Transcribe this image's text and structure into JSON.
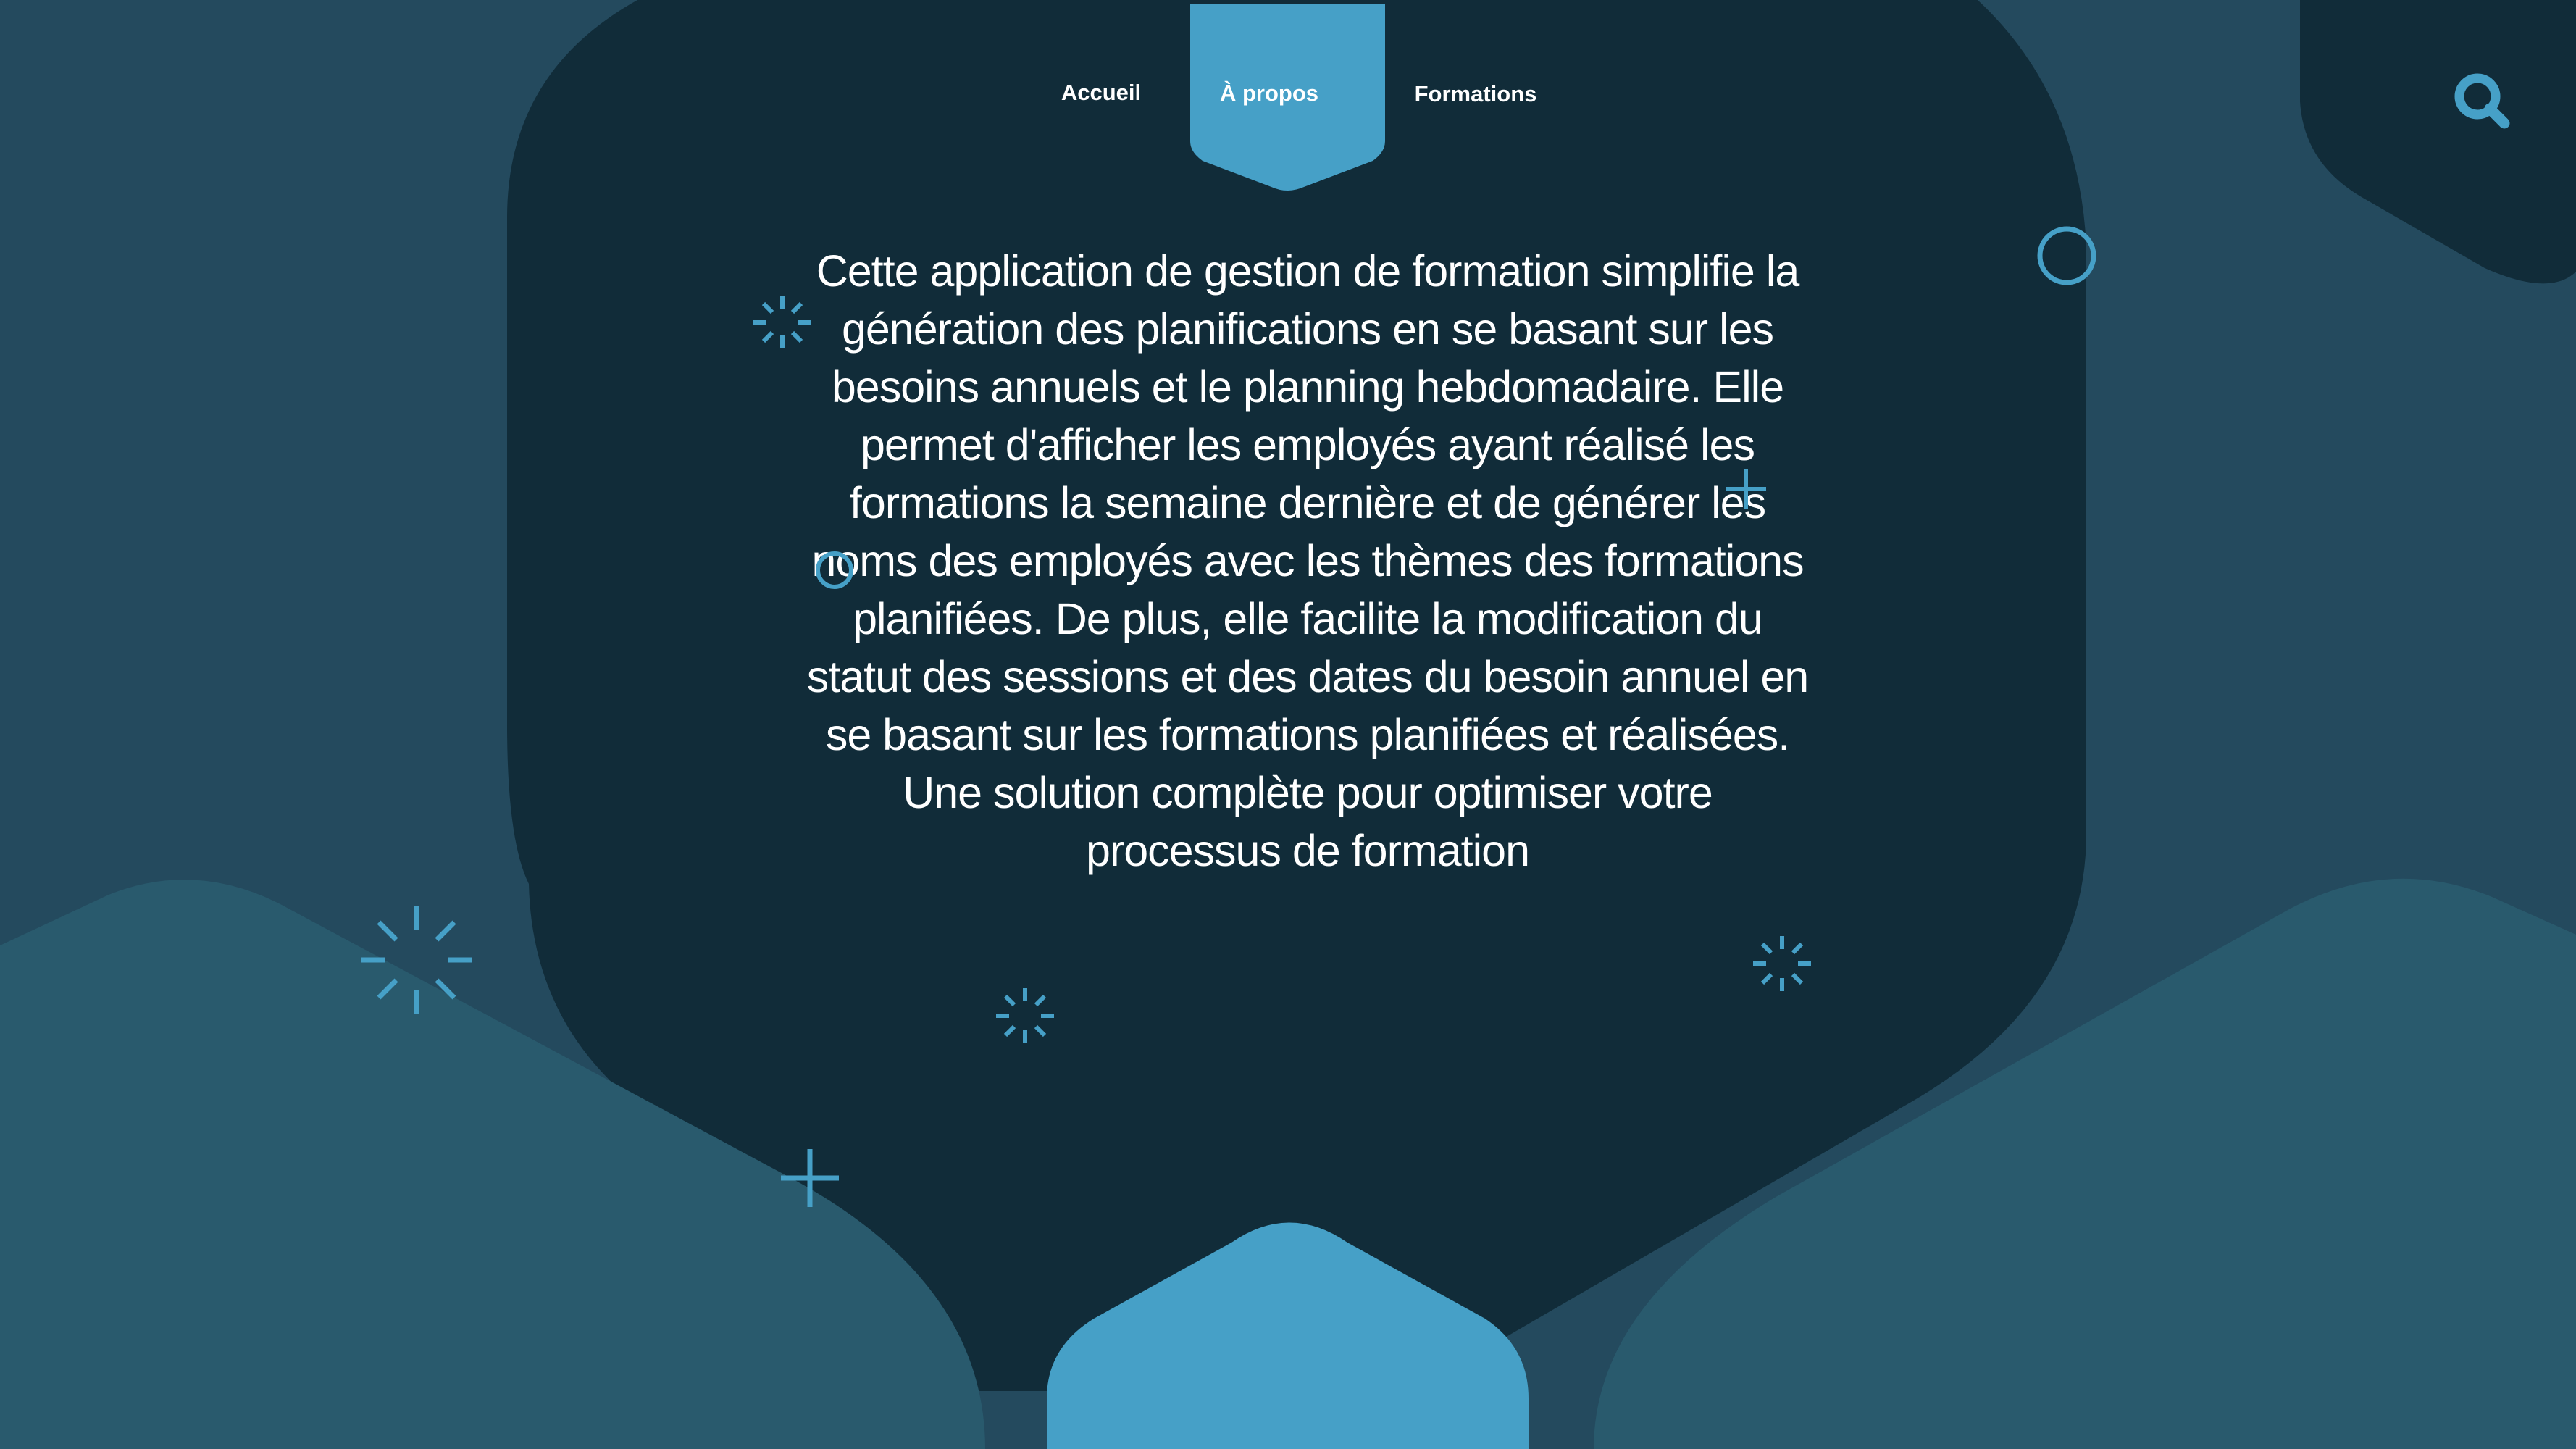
{
  "nav": {
    "items": [
      {
        "label": "Accueil",
        "active": false
      },
      {
        "label": "À propos",
        "active": true
      },
      {
        "label": "Formations",
        "active": false
      }
    ]
  },
  "search": {
    "icon": "search-icon"
  },
  "main": {
    "description": "Cette application de gestion de formation simplifie la génération des planifications en se basant sur les besoins annuels et le planning hebdomadaire. Elle permet d'afficher les employés ayant réalisé les formations la semaine dernière et de générer les noms des employés avec les thèmes des formations planifiées. De plus, elle facilite la modification du statut des sessions et des dates du besoin annuel en se basant sur les formations planifiées et réalisées. Une solution complète pour optimiser votre processus de formation"
  },
  "colors": {
    "background": "#244a5e",
    "panel": "#112c39",
    "accent": "#46a0c7",
    "hill": "#295a6d",
    "text": "#ffffff"
  }
}
